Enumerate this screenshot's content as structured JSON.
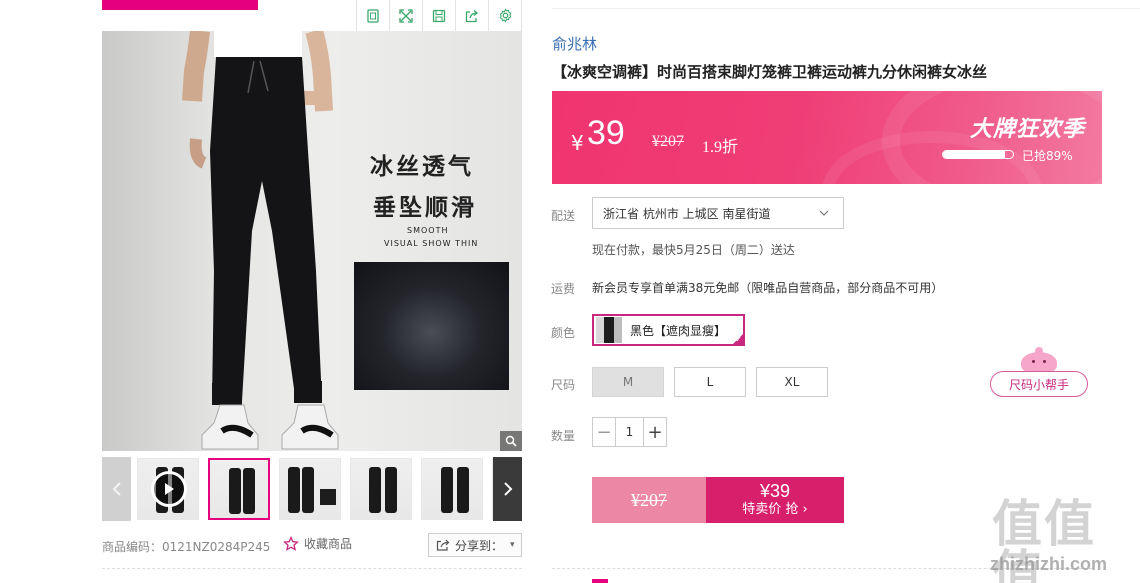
{
  "product": {
    "brand": "俞兆林",
    "title": "【冰爽空调裤】时尚百搭束脚灯笼裤卫裤运动裤九分休闲裤女冰丝",
    "code_label": "商品编码：0121NZ0284P245",
    "favorite_label": "收藏商品",
    "share_label": "分享到："
  },
  "image": {
    "tagline_line1": "冰丝透气",
    "tagline_line2": "垂坠顺滑",
    "eng_line1": "SMOOTH",
    "eng_line2": "VISUAL SHOW THIN"
  },
  "price": {
    "currency": "¥",
    "current": "39",
    "original": "¥207",
    "discount": "1.9折",
    "promo_title": "大牌狂欢季",
    "sold_label": "已抢89%",
    "sold_fraction": 0.89,
    "banner_color": "#ef3e77"
  },
  "delivery": {
    "label": "配送",
    "address": "浙江省 杭州市 上城区 南星街道",
    "estimate": "现在付款，最快5月25日（周二）送达"
  },
  "shipping": {
    "label": "运费",
    "text": "新会员专享首单满38元免邮（限唯品自营商品，部分商品不可用）"
  },
  "color": {
    "label": "颜色",
    "selected": "黑色【遮肉显瘦】"
  },
  "size": {
    "label": "尺码",
    "options": [
      "M",
      "L",
      "XL"
    ],
    "helper": "尺码小帮手"
  },
  "quantity": {
    "label": "数量",
    "value": "1",
    "minus": "−",
    "plus": "+"
  },
  "buy": {
    "original_price": "¥207",
    "price": "¥39",
    "label": "特卖价 抢 ›"
  },
  "watermark": {
    "cn": "值值值",
    "en": "zhizhizhi.com"
  },
  "icons": [
    "copy-icon",
    "expand-icon",
    "save-icon",
    "share-icon",
    "settings-icon",
    "zoom-icon",
    "play-icon",
    "star-icon",
    "chevron-down-icon"
  ],
  "colors": {
    "accent": "#e4007f",
    "buy_button": "#d81f6c",
    "buy_original": "#ec87a6",
    "brand_link": "#3a6fb3"
  }
}
